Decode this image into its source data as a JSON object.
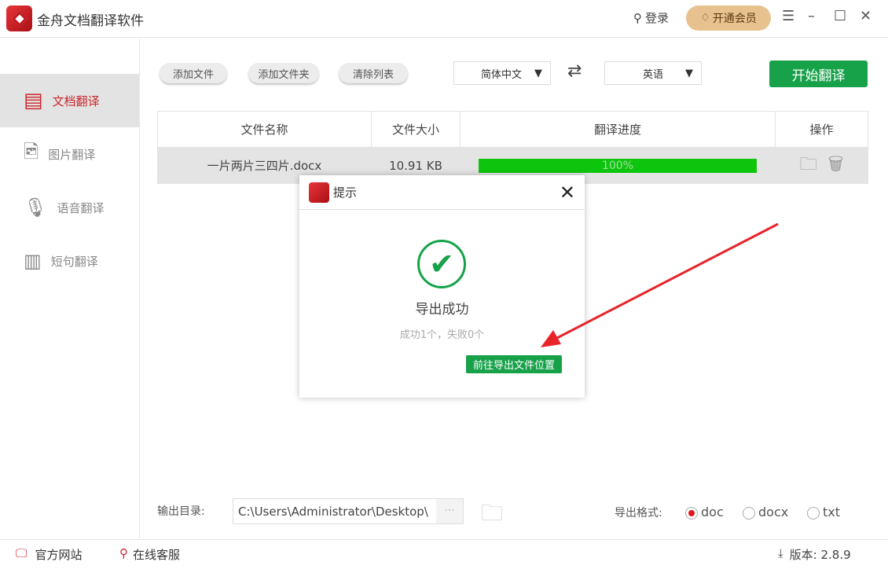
{
  "app": {
    "title": "金舟文档翻译软件",
    "login": "登录",
    "vip": "开通会员"
  },
  "sidebar": {
    "items": [
      {
        "label": "文档翻译"
      },
      {
        "label": "图片翻译"
      },
      {
        "label": "语音翻译"
      },
      {
        "label": "短句翻译"
      }
    ]
  },
  "toolbar": {
    "add_file": "添加文件",
    "add_folder": "添加文件夹",
    "clear_list": "清除列表",
    "source_lang": "简体中文",
    "target_lang": "英语",
    "start": "开始翻译"
  },
  "table": {
    "headers": [
      "文件名称",
      "文件大小",
      "翻译进度",
      "操作"
    ],
    "rows": [
      {
        "name": "一片两片三四片.docx",
        "size": "10.91 KB",
        "progress_label": "100%",
        "progress": 100
      }
    ]
  },
  "dialog": {
    "title": "提示",
    "heading": "导出成功",
    "summary": "成功1个，失败0个",
    "go_button": "前往导出文件位置"
  },
  "output": {
    "label": "输出目录:",
    "path": "C:\\Users\\Administrator\\Desktop\\",
    "browse": "···",
    "format_label": "导出格式:",
    "formats": [
      "doc",
      "docx",
      "txt"
    ],
    "selected_format": "doc"
  },
  "footer": {
    "website": "官方网站",
    "support": "在线客服",
    "version": "版本: 2.8.9"
  },
  "colors": {
    "accent": "#17a24a",
    "brand": "#c9252b",
    "progress": "#0ec50e"
  }
}
